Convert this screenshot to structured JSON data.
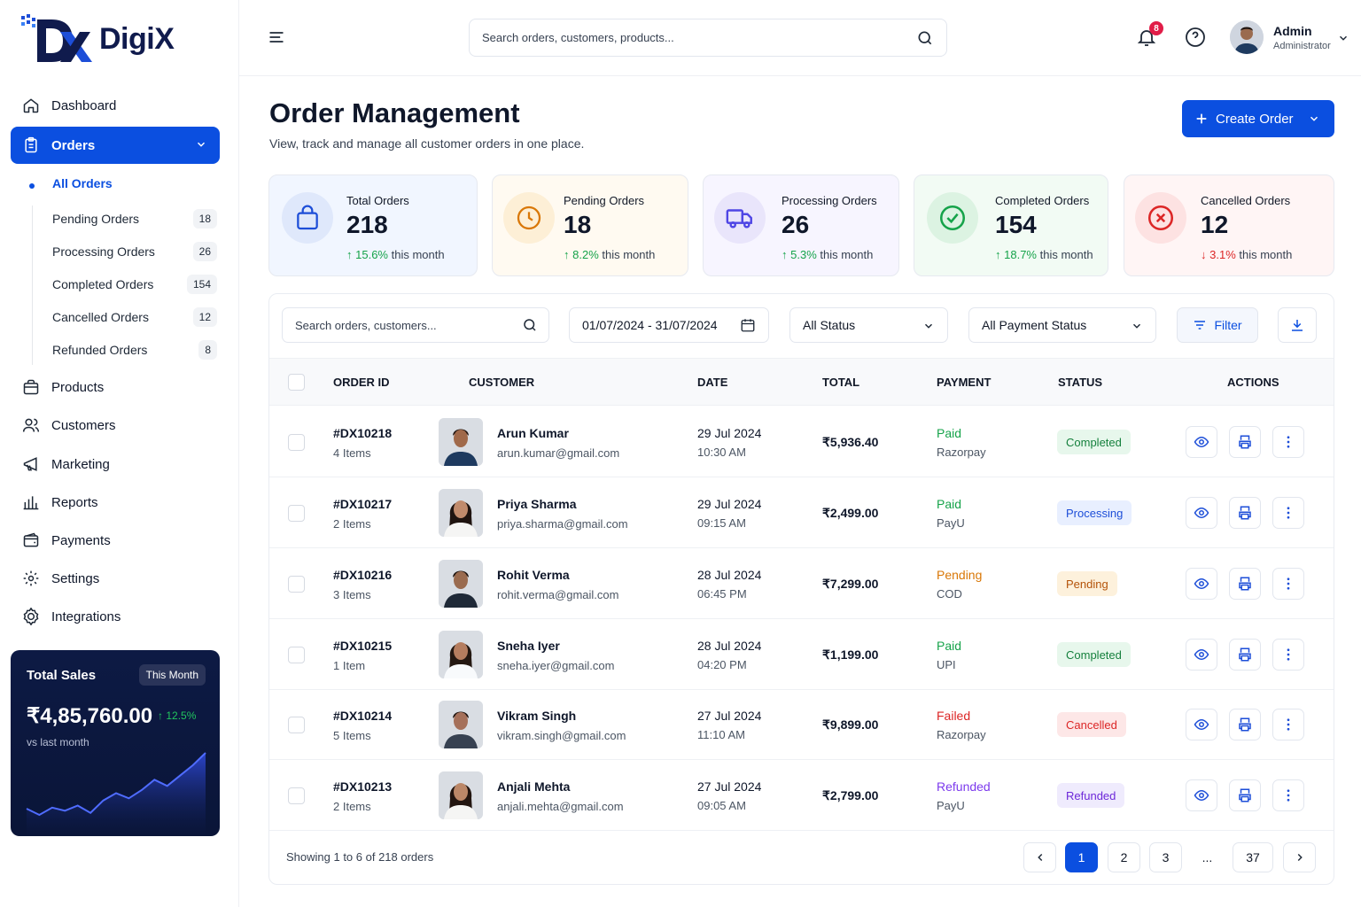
{
  "brand": {
    "name": "DigiX"
  },
  "sidebar": {
    "items": [
      {
        "label": "Dashboard",
        "icon": "home-icon"
      },
      {
        "label": "Orders",
        "icon": "clipboard-icon"
      },
      {
        "label": "Products",
        "icon": "box-icon"
      },
      {
        "label": "Customers",
        "icon": "users-icon"
      },
      {
        "label": "Marketing",
        "icon": "megaphone-icon"
      },
      {
        "label": "Reports",
        "icon": "bar-chart-icon"
      },
      {
        "label": "Payments",
        "icon": "wallet-icon"
      },
      {
        "label": "Settings",
        "icon": "gear-icon"
      },
      {
        "label": "Integrations",
        "icon": "cog-icon"
      }
    ],
    "sub_active": "All Orders",
    "sub_items": [
      {
        "label": "Pending Orders",
        "count": "18"
      },
      {
        "label": "Processing Orders",
        "count": "26"
      },
      {
        "label": "Completed Orders",
        "count": "154"
      },
      {
        "label": "Cancelled Orders",
        "count": "12"
      },
      {
        "label": "Refunded Orders",
        "count": "8"
      }
    ],
    "sales": {
      "title": "Total Sales",
      "period": "This Month",
      "amount": "₹4,85,760.00",
      "change": "12.5%",
      "compare": "vs last month",
      "sparkline": [
        30,
        24,
        31,
        28,
        33,
        26,
        38,
        45,
        40,
        48,
        58,
        52,
        62,
        72,
        84
      ]
    }
  },
  "header": {
    "search_placeholder": "Search orders, customers, products...",
    "notifications": "8",
    "user_name": "Admin",
    "user_role": "Administrator"
  },
  "page": {
    "title": "Order Management",
    "subtitle": "View, track and manage all customer orders in one place.",
    "create_label": "Create Order"
  },
  "stats": [
    {
      "label": "Total Orders",
      "value": "218",
      "change": "15.6%",
      "suffix": "this month",
      "dir": "up"
    },
    {
      "label": "Pending Orders",
      "value": "18",
      "change": "8.2%",
      "suffix": "this month",
      "dir": "up"
    },
    {
      "label": "Processing Orders",
      "value": "26",
      "change": "5.3%",
      "suffix": "this month",
      "dir": "up"
    },
    {
      "label": "Completed Orders",
      "value": "154",
      "change": "18.7%",
      "suffix": "this month",
      "dir": "up"
    },
    {
      "label": "Cancelled Orders",
      "value": "12",
      "change": "3.1%",
      "suffix": "this month",
      "dir": "down"
    }
  ],
  "filters": {
    "search_placeholder": "Search orders, customers...",
    "date_range": "01/07/2024 - 31/07/2024",
    "status": "All Status",
    "payment_status": "All Payment Status",
    "filter_label": "Filter"
  },
  "table": {
    "headers": [
      "ORDER ID",
      "CUSTOMER",
      "DATE",
      "TOTAL",
      "PAYMENT",
      "STATUS",
      "ACTIONS"
    ],
    "rows": [
      {
        "id": "#DX10218",
        "items": "4 Items",
        "name": "Arun Kumar",
        "email": "arun.kumar@gmail.com",
        "date": "29 Jul 2024",
        "time": "10:30 AM",
        "total": "₹5,936.40",
        "payment": "Paid",
        "method": "Razorpay",
        "status": "Completed"
      },
      {
        "id": "#DX10217",
        "items": "2 Items",
        "name": "Priya Sharma",
        "email": "priya.sharma@gmail.com",
        "date": "29 Jul 2024",
        "time": "09:15 AM",
        "total": "₹2,499.00",
        "payment": "Paid",
        "method": "PayU",
        "status": "Processing"
      },
      {
        "id": "#DX10216",
        "items": "3 Items",
        "name": "Rohit Verma",
        "email": "rohit.verma@gmail.com",
        "date": "28 Jul 2024",
        "time": "06:45 PM",
        "total": "₹7,299.00",
        "payment": "Pending",
        "method": "COD",
        "status": "Pending"
      },
      {
        "id": "#DX10215",
        "items": "1 Item",
        "name": "Sneha Iyer",
        "email": "sneha.iyer@gmail.com",
        "date": "28 Jul 2024",
        "time": "04:20 PM",
        "total": "₹1,199.00",
        "payment": "Paid",
        "method": "UPI",
        "status": "Completed"
      },
      {
        "id": "#DX10214",
        "items": "5 Items",
        "name": "Vikram Singh",
        "email": "vikram.singh@gmail.com",
        "date": "27 Jul 2024",
        "time": "11:10 AM",
        "total": "₹9,899.00",
        "payment": "Failed",
        "method": "Razorpay",
        "status": "Cancelled"
      },
      {
        "id": "#DX10213",
        "items": "2 Items",
        "name": "Anjali Mehta",
        "email": "anjali.mehta@gmail.com",
        "date": "27 Jul 2024",
        "time": "09:05 AM",
        "total": "₹2,799.00",
        "payment": "Refunded",
        "method": "PayU",
        "status": "Refunded"
      }
    ],
    "footer": "Showing 1 to 6 of 218 orders"
  },
  "pagination": {
    "pages": [
      "1",
      "2",
      "3",
      "...",
      "37"
    ],
    "current": "1"
  },
  "colors": {
    "accent": "#0b4fe0",
    "paid": "#16a34a",
    "pending": "#d97706",
    "failed": "#dc2626",
    "refunded": "#7c3aed"
  }
}
